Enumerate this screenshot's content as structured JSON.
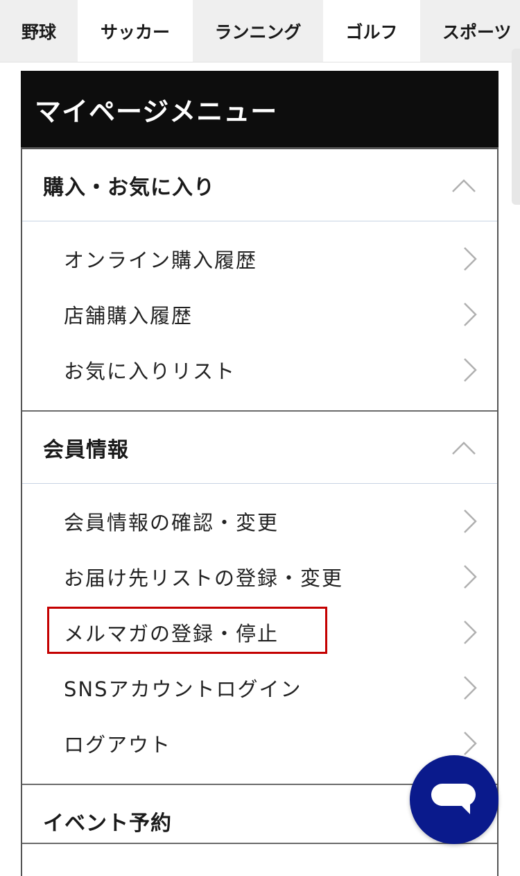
{
  "tabs": [
    {
      "label": "野球"
    },
    {
      "label": "サッカー"
    },
    {
      "label": "ランニング"
    },
    {
      "label": "ゴルフ"
    },
    {
      "label": "スポーツ"
    }
  ],
  "menu": {
    "title": "マイページメニュー",
    "sections": [
      {
        "label": "購入・お気に入り",
        "items": [
          {
            "label": "オンライン購入履歴"
          },
          {
            "label": "店舗購入履歴"
          },
          {
            "label": "お気に入りリスト"
          }
        ]
      },
      {
        "label": "会員情報",
        "items": [
          {
            "label": "会員情報の確認・変更"
          },
          {
            "label": "お届け先リストの登録・変更"
          },
          {
            "label": "メルマガの登録・停止"
          },
          {
            "label": "SNSアカウントログイン"
          },
          {
            "label": "ログアウト"
          }
        ]
      },
      {
        "label": "イベント予約",
        "items": []
      }
    ]
  },
  "colors": {
    "header_bg": "#0d0d0d",
    "highlight": "#c40000",
    "chat_button": "#0a1a8c"
  },
  "icons": {
    "expand": "chevron-up-icon",
    "item": "chevron-right-icon",
    "chat": "chat-bubble-icon"
  }
}
